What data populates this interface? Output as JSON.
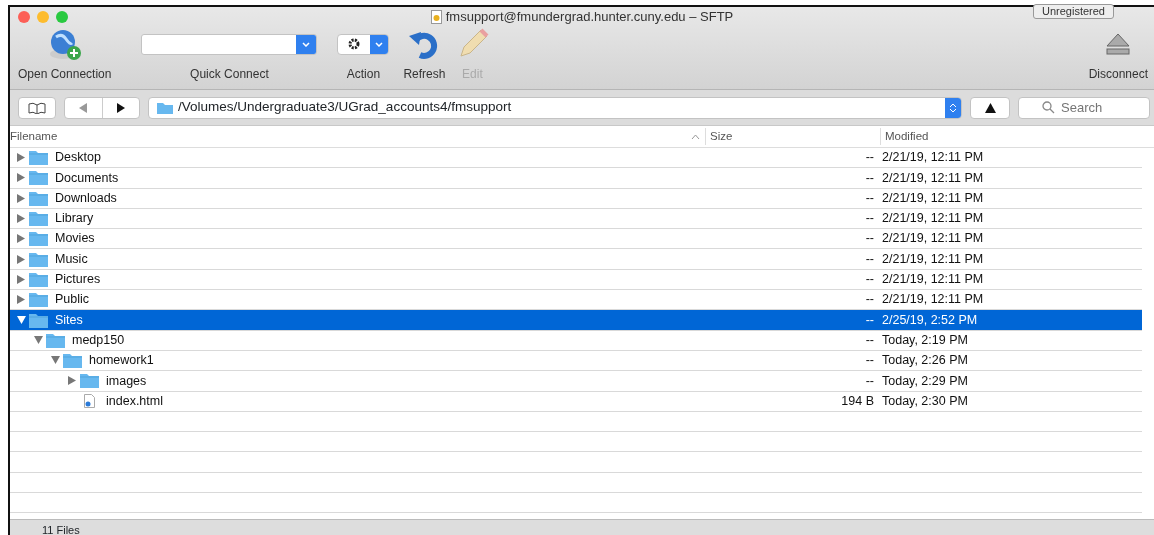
{
  "window": {
    "title": "fmsupport@fmundergrad.hunter.cuny.edu – SFTP",
    "badge": "Unregistered"
  },
  "toolbar": [
    {
      "kind": "open",
      "label": "Open Connection",
      "disabled": false
    },
    {
      "kind": "quick",
      "label": "Quick Connect",
      "disabled": false
    },
    {
      "kind": "action",
      "label": "Action",
      "disabled": false
    },
    {
      "kind": "refresh",
      "label": "Refresh",
      "disabled": false
    },
    {
      "kind": "edit",
      "label": "Edit",
      "disabled": true
    },
    {
      "kind": "disconnect",
      "label": "Disconnect",
      "disabled": false
    }
  ],
  "path_bar": {
    "path": "/Volumes/Undergraduate3/UGrad_accounts4/fmsupport",
    "search_placeholder": "Search"
  },
  "table": {
    "columns": [
      "Filename",
      "Size",
      "Modified"
    ],
    "rows": [
      {
        "name": "Desktop",
        "kind": "folder",
        "expanded": false,
        "selected": false,
        "size": "--",
        "modified": "2/21/19, 12:11 PM"
      },
      {
        "name": "Documents",
        "kind": "folder",
        "expanded": false,
        "selected": false,
        "size": "--",
        "modified": "2/21/19, 12:11 PM"
      },
      {
        "name": "Downloads",
        "kind": "folder",
        "expanded": false,
        "selected": false,
        "size": "--",
        "modified": "2/21/19, 12:11 PM"
      },
      {
        "name": "Library",
        "kind": "folder",
        "expanded": false,
        "selected": false,
        "size": "--",
        "modified": "2/21/19, 12:11 PM"
      },
      {
        "name": "Movies",
        "kind": "folder",
        "expanded": false,
        "selected": false,
        "size": "--",
        "modified": "2/21/19, 12:11 PM"
      },
      {
        "name": "Music",
        "kind": "folder",
        "expanded": false,
        "selected": false,
        "size": "--",
        "modified": "2/21/19, 12:11 PM"
      },
      {
        "name": "Pictures",
        "kind": "folder",
        "expanded": false,
        "selected": false,
        "size": "--",
        "modified": "2/21/19, 12:11 PM"
      },
      {
        "name": "Public",
        "kind": "folder",
        "expanded": false,
        "selected": false,
        "size": "--",
        "modified": "2/21/19, 12:11 PM"
      },
      {
        "name": "Sites",
        "kind": "folder",
        "expanded": true,
        "selected": true,
        "size": "--",
        "modified": "2/25/19, 2:52 PM",
        "children": [
          {
            "name": "medp150",
            "kind": "folder",
            "expanded": true,
            "selected": false,
            "size": "--",
            "modified": "Today, 2:19 PM",
            "children": [
              {
                "name": "homework1",
                "kind": "folder",
                "expanded": true,
                "selected": false,
                "size": "--",
                "modified": "Today, 2:26 PM",
                "children": [
                  {
                    "name": "images",
                    "kind": "folder",
                    "expanded": false,
                    "selected": false,
                    "size": "--",
                    "modified": "Today, 2:29 PM"
                  },
                  {
                    "name": "index.html",
                    "kind": "file",
                    "selected": false,
                    "size": "194 B",
                    "modified": "Today, 2:30 PM"
                  }
                ]
              }
            ]
          }
        ]
      }
    ]
  },
  "status_bar": "11 Files"
}
